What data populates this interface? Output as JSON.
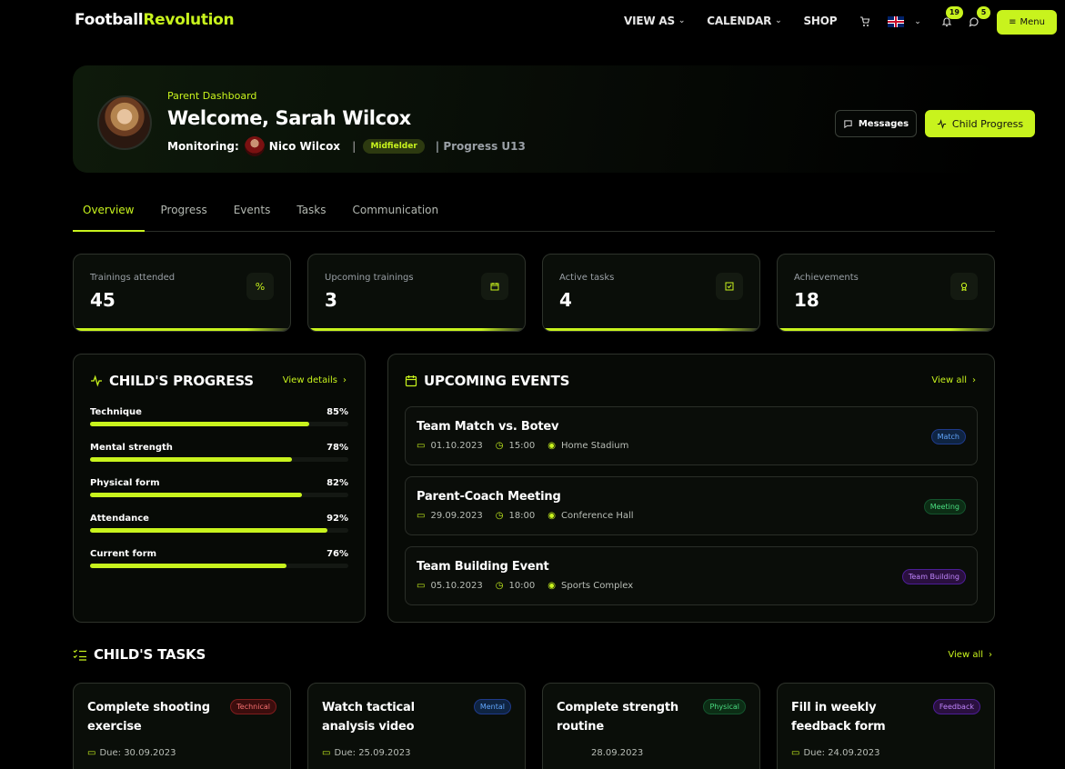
{
  "nav": {
    "logo_part1": "Football",
    "logo_part2": "Revolution",
    "links": [
      "VIEW AS",
      "CALENDAR",
      "SHOP"
    ],
    "notifications_count": "19",
    "messages_count": "5",
    "menu_label": "Menu"
  },
  "hero": {
    "subtitle": "Parent Dashboard",
    "title": "Welcome, Sarah Wilcox",
    "monitoring_label": "Monitoring:",
    "child_name": "Nico Wilcox",
    "separator": "|",
    "position": "Midfielder",
    "program": "| Progress U13",
    "messages_btn": "Messages",
    "progress_btn": "Child Progress"
  },
  "tabs": [
    "Overview",
    "Progress",
    "Events",
    "Tasks",
    "Communication"
  ],
  "stats": [
    {
      "label": "Trainings attended",
      "value": "45",
      "icon": "percent-icon"
    },
    {
      "label": "Upcoming trainings",
      "value": "3",
      "icon": "calendar-icon"
    },
    {
      "label": "Active tasks",
      "value": "4",
      "icon": "checkbox-icon"
    },
    {
      "label": "Achievements",
      "value": "18",
      "icon": "award-icon"
    }
  ],
  "progress": {
    "title": "CHILD'S PROGRESS",
    "link": "View details",
    "items": [
      {
        "label": "Technique",
        "value_text": "85%",
        "value": 85
      },
      {
        "label": "Mental strength",
        "value_text": "78%",
        "value": 78
      },
      {
        "label": "Physical form",
        "value_text": "82%",
        "value": 82
      },
      {
        "label": "Attendance",
        "value_text": "92%",
        "value": 92
      },
      {
        "label": "Current form",
        "value_text": "76%",
        "value": 76
      }
    ]
  },
  "events": {
    "title": "UPCOMING EVENTS",
    "link": "View all",
    "items": [
      {
        "title": "Team Match vs. Botev",
        "date": "01.10.2023",
        "time": "15:00",
        "place": "Home Stadium",
        "tag": "Match"
      },
      {
        "title": "Parent-Coach Meeting",
        "date": "29.09.2023",
        "time": "18:00",
        "place": "Conference Hall",
        "tag": "Meeting"
      },
      {
        "title": "Team Building Event",
        "date": "05.10.2023",
        "time": "10:00",
        "place": "Sports Complex",
        "tag": "Team Building"
      }
    ]
  },
  "tasks": {
    "title": "CHILD'S TASKS",
    "link": "View all",
    "items": [
      {
        "title": "Complete shooting exercise",
        "tag": "Technical",
        "due": "Due: 30.09.2023"
      },
      {
        "title": "Watch tactical analysis video",
        "tag": "Mental",
        "due": "Due: 25.09.2023"
      },
      {
        "title": "Complete strength routine",
        "tag": "Physical",
        "due": "28.09.2023"
      },
      {
        "title": "Fill in weekly feedback form",
        "tag": "Feedback",
        "due": "Due: 24.09.2023"
      }
    ]
  }
}
